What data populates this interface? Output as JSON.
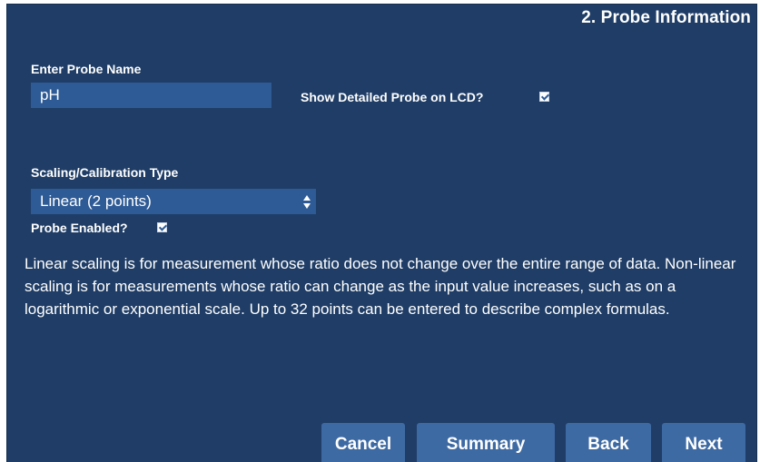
{
  "panel": {
    "title": "2. Probe Information"
  },
  "probe_name": {
    "label": "Enter Probe Name",
    "value": "pH"
  },
  "show_detailed": {
    "label": "Show Detailed Probe on LCD?",
    "checked": true
  },
  "scaling": {
    "label": "Scaling/Calibration Type",
    "selected": "Linear (2 points)"
  },
  "probe_enabled": {
    "label": "Probe Enabled?",
    "checked": true
  },
  "description": "Linear scaling is for measurement whose ratio does not change over the entire range of data. Non-linear scaling is for measurements whose ratio can change as the input value increases, such as on a logarithmic or exponential scale. Up to 32 points can be entered to describe complex formulas.",
  "buttons": {
    "cancel": "Cancel",
    "summary": "Summary",
    "back": "Back",
    "next": "Next"
  },
  "colors": {
    "panel_background": "#1f3d66",
    "field_background": "#2e5b96",
    "button_background": "#3e6aa3",
    "text": "#ffffff"
  }
}
